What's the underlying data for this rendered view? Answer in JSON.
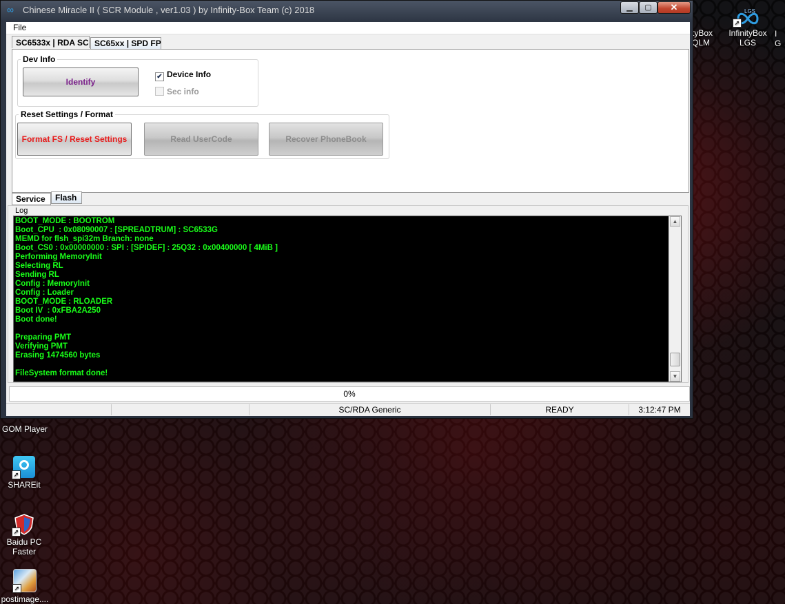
{
  "window": {
    "title": "Chinese Miracle II ( SCR Module , ver1.03 ) by Infinity-Box Team (c) 2018",
    "min_glyph": "▁",
    "max_glyph": "▢",
    "close_glyph": "✕"
  },
  "menu": {
    "file": "File"
  },
  "top_tabs": [
    "SC6533x | RDA SC",
    "SC65xx | SPD FP"
  ],
  "dev_info": {
    "legend": "Dev Info",
    "identify_button": "Identify",
    "device_info_label": "Device Info",
    "device_info_checked": true,
    "sec_info_label": "Sec info",
    "sec_info_checked": false
  },
  "reset": {
    "legend": "Reset Settings / Format",
    "format_button": "Format FS / Reset Settings",
    "read_usercode_button": "Read UserCode",
    "recover_phonebook_button": "Recover PhoneBook"
  },
  "bottom_tabs": [
    "Service",
    "Flash"
  ],
  "log": {
    "label": "Log",
    "lines": [
      "BOOT_MODE : BOOTROM",
      "Boot_CPU  : 0x08090007 : [SPREADTRUM] : SC6533G",
      "MEMD for flsh_spi32m Branch: none",
      "Boot_CS0 : 0x00000000 : SPI : [SPIDEF] : 25Q32 : 0x00400000 [ 4MiB ]",
      "Performing MemoryInit",
      "Selecting RL",
      "Sending RL",
      "Config : MemoryInit",
      "Config : Loader",
      "BOOT_MODE : RLOADER",
      "Boot IV  : 0xFBA2A250",
      "Boot done!",
      "",
      "Preparing PMT",
      "Verifying PMT",
      "Erasing 1474560 bytes",
      "",
      "FileSystem format done!"
    ]
  },
  "progress": {
    "text": "0%",
    "value": 0
  },
  "statusbar": {
    "cell1": "",
    "cell2": "",
    "module": "SC/RDA Generic",
    "state": "READY",
    "time": "3:12:47 PM"
  },
  "desktop": {
    "icons": [
      {
        "label": "tyBox\nQLM"
      },
      {
        "label": "InfinityBox\nLGS",
        "badge": "LGS"
      },
      {
        "label": "I\nG"
      },
      {
        "label": "GOM Player"
      },
      {
        "label": "SHAREit"
      },
      {
        "label": "Baidu PC\nFaster"
      },
      {
        "label": "postimage...."
      }
    ]
  },
  "colors": {
    "log_text": "#19ff19",
    "log_bg": "#000000",
    "identify_text": "#7a1f8a",
    "format_text": "#e81c1c"
  }
}
